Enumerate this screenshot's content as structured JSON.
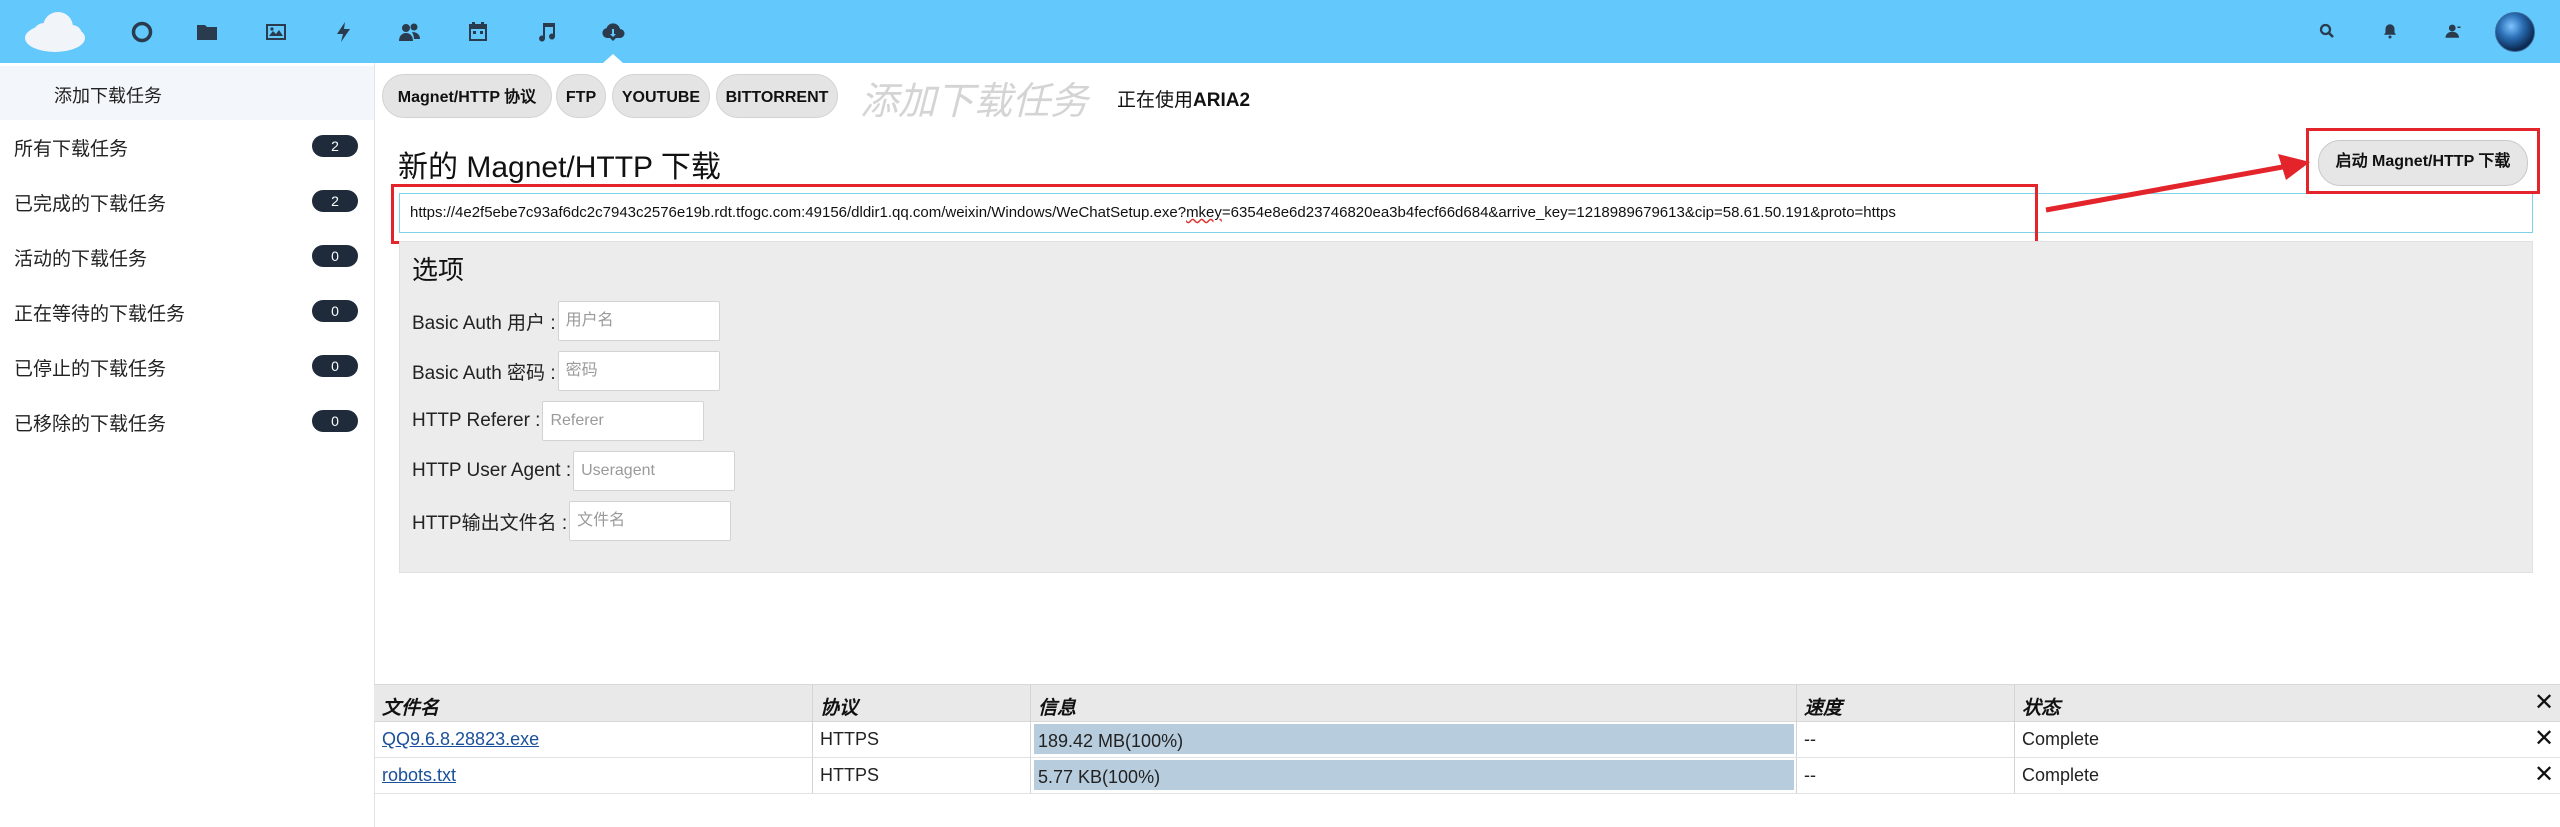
{
  "topbar": {
    "apps": [
      "circle-icon",
      "folder-icon",
      "image-icon",
      "lightning-icon",
      "contacts-icon",
      "calendar-icon",
      "music-icon",
      "cloud-download-icon"
    ],
    "right_icons": [
      "search-icon",
      "bell-icon",
      "user-icon"
    ],
    "accent": "#63c8fb"
  },
  "sidebar": {
    "new_task": "添加下载任务",
    "items": [
      {
        "label": "所有下载任务",
        "count": "2"
      },
      {
        "label": "已完成的下载任务",
        "count": "2"
      },
      {
        "label": "活动的下载任务",
        "count": "0"
      },
      {
        "label": "正在等待的下载任务",
        "count": "0"
      },
      {
        "label": "已停止的下载任务",
        "count": "0"
      },
      {
        "label": "已移除的下载任务",
        "count": "0"
      }
    ]
  },
  "tabs": {
    "items": [
      "Magnet/HTTP 协议",
      "FTP",
      "YOUTUBE",
      "BITTORRENT"
    ],
    "title": "添加下载任务",
    "using_prefix": "正在使用",
    "using_engine": "ARIA2"
  },
  "form": {
    "title": "新的 Magnet/HTTP 下载",
    "url_part1": "https://4e2f5ebe7c93af6dc2c7943c2576e19b.rdt.tfogc.com:49156/dldir1.qq.com/weixin/Windows/WeChatSetup.exe?",
    "url_part2": "mkey",
    "url_part3": "=6354e8e6d23746820ea3b4fecf66d684&arrive_key=1218989679613&cip=58.61.50.191&proto=https",
    "start_button": "启动 Magnet/HTTP 下载",
    "options_title": "选项",
    "options": [
      {
        "label": "Basic Auth 用户 :",
        "placeholder": "用户名"
      },
      {
        "label": "Basic Auth 密码 :",
        "placeholder": "密码"
      },
      {
        "label": "HTTP Referer :",
        "placeholder": "Referer"
      },
      {
        "label": "HTTP User Agent :",
        "placeholder": "Useragent"
      },
      {
        "label": "HTTP输出文件名 :",
        "placeholder": "文件名"
      }
    ]
  },
  "table": {
    "headers": [
      "文件名",
      "协议",
      "信息",
      "速度",
      "状态"
    ],
    "rows": [
      {
        "file": "QQ9.6.8.28823.exe",
        "protocol": "HTTPS",
        "info": "189.42 MB(100%)",
        "progress": 1.0,
        "speed": "--",
        "status": "Complete"
      },
      {
        "file": "robots.txt",
        "protocol": "HTTPS",
        "info": "5.77 KB(100%)",
        "progress": 1.0,
        "speed": "--",
        "status": "Complete"
      }
    ],
    "close_symbol": "✕"
  }
}
